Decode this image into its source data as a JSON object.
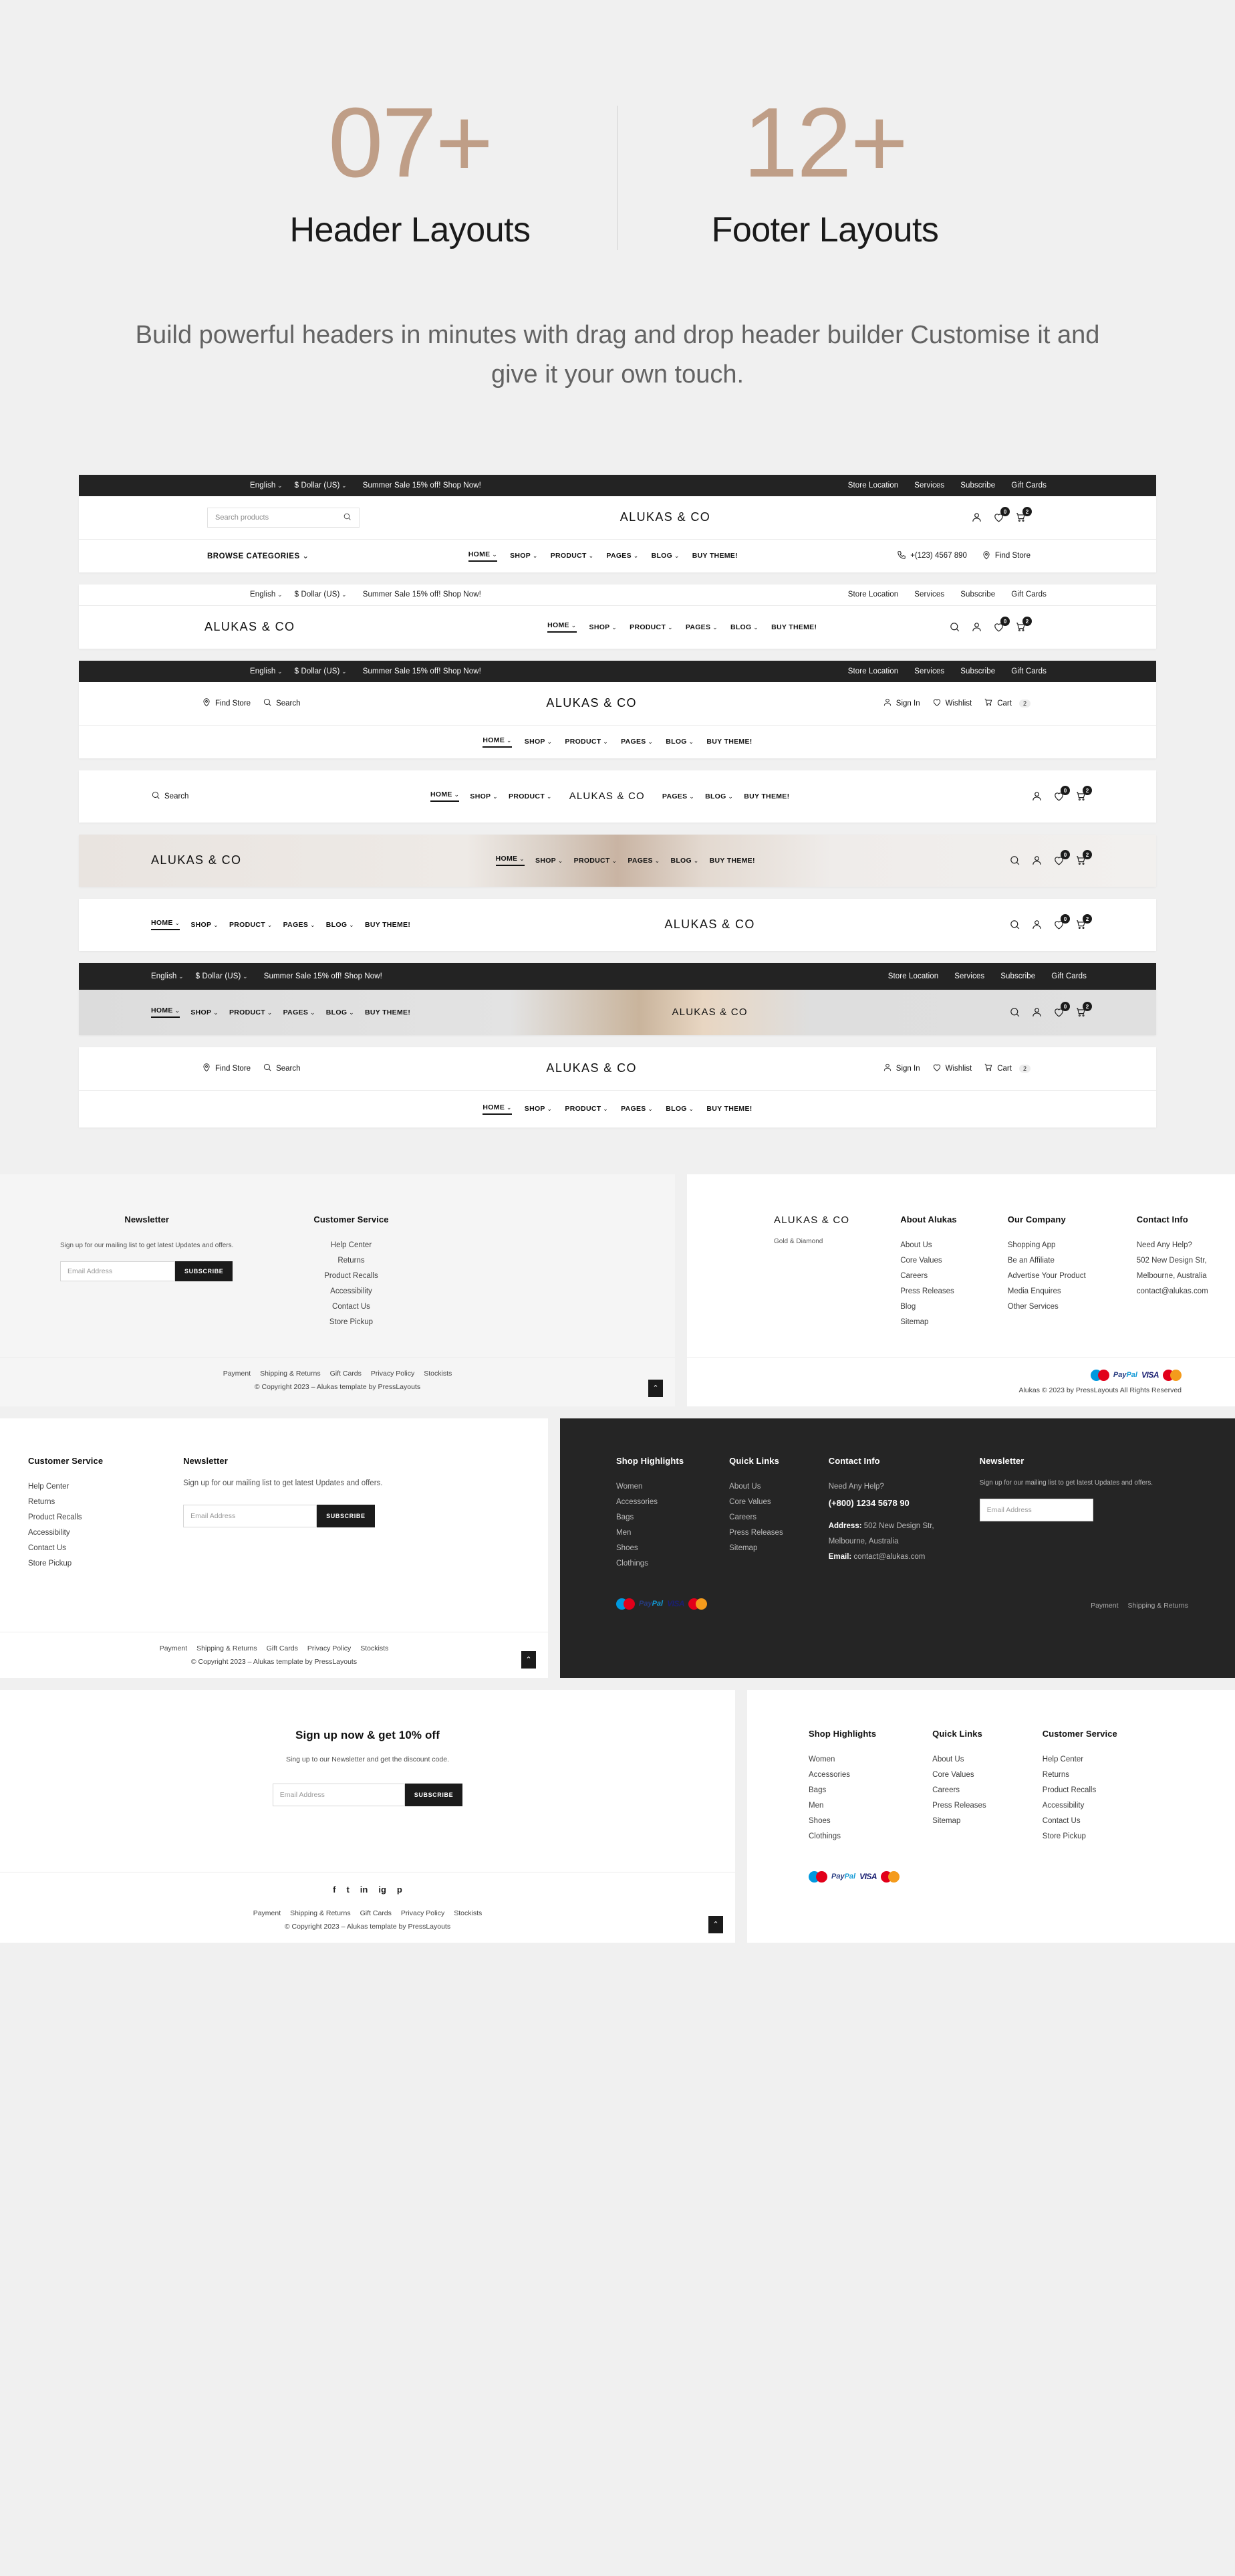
{
  "hero": {
    "stats": [
      {
        "number": "07+",
        "label": "Header Layouts"
      },
      {
        "number": "12+",
        "label": "Footer Layouts"
      }
    ],
    "description": "Build powerful headers in minutes with drag and drop header builder Customise it and give it your own touch.",
    "accent_color": "#bf9e87"
  },
  "common": {
    "brand": "ALUKAS & CO",
    "topbar_left": {
      "language": "English",
      "currency": "$ Dollar (US)",
      "promo": "Summer Sale 15% off! Shop Now!"
    },
    "topbar_right": [
      "Store Location",
      "Services",
      "Subscribe",
      "Gift Cards"
    ],
    "nav": [
      {
        "label": "HOME",
        "caret": true,
        "active": true
      },
      {
        "label": "SHOP",
        "caret": true,
        "active": false
      },
      {
        "label": "PRODUCT",
        "caret": true,
        "active": false
      },
      {
        "label": "PAGES",
        "caret": true,
        "active": false
      },
      {
        "label": "BLOG",
        "caret": true,
        "active": false
      },
      {
        "label": "BUY THEME!",
        "caret": false,
        "active": false
      }
    ],
    "search_placeholder": "Search products",
    "search_label": "Search",
    "browse_categories": "BROWSE CATEGORIES",
    "phone": "+(123) 4567 890",
    "find_store": "Find Store",
    "sign_in": "Sign In",
    "wishlist": "Wishlist",
    "cart": "Cart",
    "cart_count": "2",
    "wishlist_count": "0"
  },
  "headers": [
    {
      "id": "header-1",
      "variant": "topbar-dark-search-left"
    },
    {
      "id": "header-2",
      "variant": "topbar-light-logo-left"
    },
    {
      "id": "header-3",
      "variant": "topbar-dark-centered-logo"
    },
    {
      "id": "header-4",
      "variant": "split-nav-center-logo"
    },
    {
      "id": "header-5",
      "variant": "transparent-over-image"
    },
    {
      "id": "header-6",
      "variant": "nav-left-logo-center"
    },
    {
      "id": "header-7",
      "variant": "dark-topbar-over-image"
    },
    {
      "id": "header-8",
      "variant": "centered-logo-two-row"
    }
  ],
  "footers": {
    "newsletter_title": "Newsletter",
    "newsletter_desc": "Sign up for our mailing list to get latest Updates and offers.",
    "email_placeholder": "Email Address",
    "subscribe_label": "SUBSCRIBE",
    "customer_service_title": "Customer Service",
    "customer_service": [
      "Help Center",
      "Returns",
      "Product Recalls",
      "Accessibility",
      "Contact Us",
      "Store Pickup"
    ],
    "about_title": "About Alukas",
    "about": [
      "About Us",
      "Core Values",
      "Careers",
      "Press Releases",
      "Blog",
      "Sitemap"
    ],
    "company_title": "Our Company",
    "company": [
      "Shopping App",
      "Be an Affiliate",
      "Advertise Your Product",
      "Media Enquires",
      "Other Services"
    ],
    "shop_highlights_title": "Shop Highlights",
    "shop_highlights": [
      "Women",
      "Accessories",
      "Bags",
      "Men",
      "Shoes",
      "Clothings"
    ],
    "quick_links_title": "Quick Links",
    "quick_links": [
      "About Us",
      "Core Values",
      "Careers",
      "Press Releases",
      "Sitemap"
    ],
    "contact_title": "Contact Info",
    "contact_need_help": "Need Any Help?",
    "contact_phone": "(+800) 1234 5678 90",
    "contact_address_label": "Address:",
    "contact_address": "502 New Design Str,",
    "contact_city": "Melbourne, Australia",
    "contact_email_label": "Email:",
    "contact_email": "contact@alukas.com",
    "tagline": "Gold & Diamond",
    "signup_title": "Sign up now & get 10% off",
    "signup_desc": "Sing up to our Newsletter and get the discount code.",
    "bottom_links": [
      "Payment",
      "Shipping & Returns",
      "Gift Cards",
      "Privacy Policy",
      "Stockists"
    ],
    "copyright": "© Copyright 2023 – Alukas template by PressLayouts",
    "copyright_alt": "Alukas © 2023 by PressLayouts All Rights Reserved",
    "social": [
      "f",
      "t",
      "in",
      "ig",
      "p"
    ],
    "payment_methods": [
      "Maestro",
      "PayPal",
      "VISA",
      "MasterCard"
    ],
    "back_to_top": "⌃"
  }
}
